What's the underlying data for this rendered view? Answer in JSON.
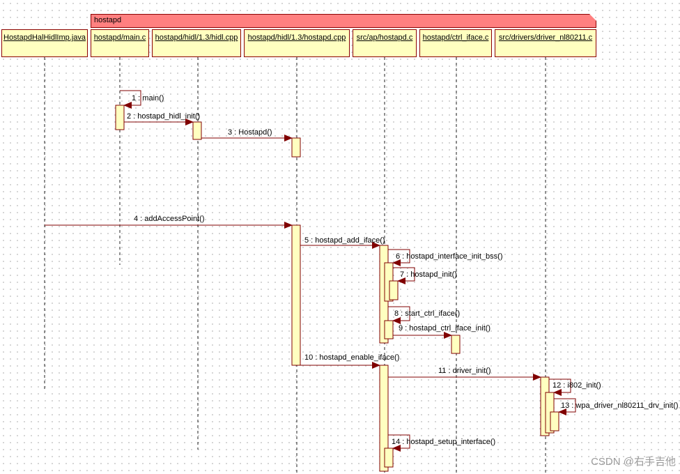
{
  "frame": {
    "label": "hostapd"
  },
  "lifelines": [
    "HostapdHalHidlImp.java",
    "hostapd/main.c",
    "hostapd/hidl/1.3/hidl.cpp",
    "hostapd/hidl/1.3/hostapd.cpp",
    "src/ap/hostapd.c",
    "hostapd/ctrl_iface.c",
    "src/drivers/driver_nl80211.c"
  ],
  "messages": [
    "1 : main()",
    "2 : hostapd_hidl_init()",
    "3 : Hostapd()",
    "4 : addAccessPoint()",
    "5 : hostapd_add_iface()",
    "6 : hostapd_interface_init_bss()",
    "7 : hostapd_init()",
    "8 : start_ctrl_iface()",
    "9 : hostapd_ctrl_iface_init()",
    "10 : hostapd_enable_iface()",
    "11 : driver_init()",
    "12 : i802_init()",
    "13 : wpa_driver_nl80211_drv_init()",
    "14 : hostapd_setup_interface()"
  ],
  "watermark": "CSDN @右手吉他",
  "colors": {
    "frame": "#ff8080",
    "box": "#ffffc0",
    "line": "#800000"
  }
}
